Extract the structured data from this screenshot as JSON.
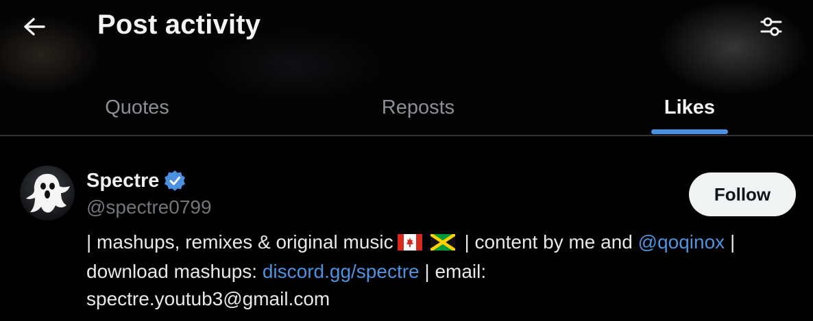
{
  "header": {
    "title": "Post activity",
    "back_icon": "arrow-left-icon",
    "filter_icon": "sliders-icon"
  },
  "tabs": [
    {
      "label": "Quotes",
      "selected": false
    },
    {
      "label": "Reposts",
      "selected": false
    },
    {
      "label": "Likes",
      "selected": true
    }
  ],
  "colors": {
    "accent": "#4a90df",
    "link": "#4f93e0",
    "background": "#000000",
    "muted": "#71767b"
  },
  "user": {
    "name": "Spectre",
    "verified_icon": "verified-badge-icon",
    "handle": "@spectre0799",
    "follow_label": "Follow",
    "bio": {
      "part1": "| mashups, remixes & original music",
      "flag1_icon": "canada-flag-icon",
      "flag2_icon": "jamaica-flag-icon",
      "part2": "| content by me and",
      "mention": "@qoqinox",
      "part3": "|",
      "part4": "download mashups:",
      "link": "discord.gg/spectre",
      "part5": "| email:",
      "email": "spectre.youtub3@gmail.com"
    }
  }
}
